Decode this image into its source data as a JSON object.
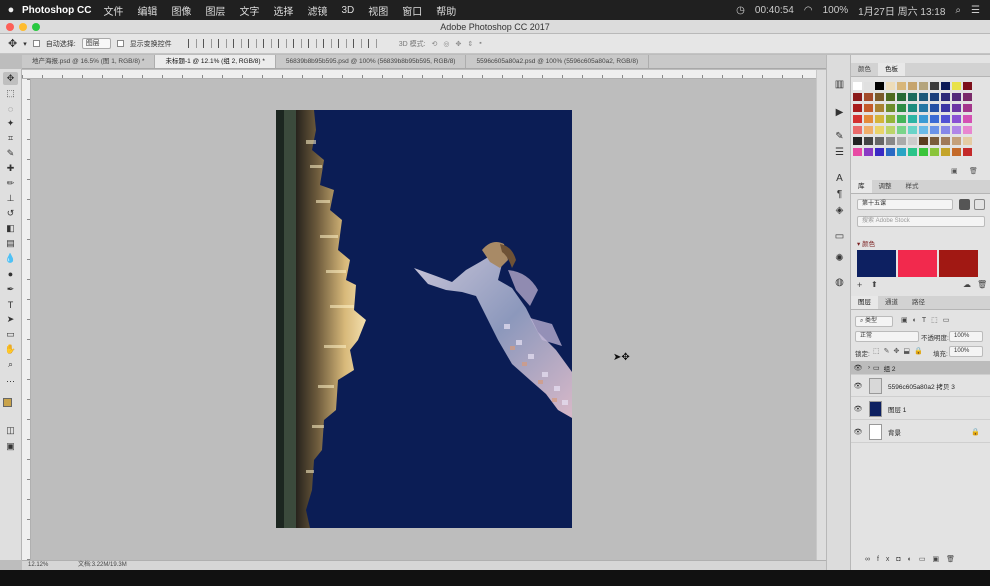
{
  "menubar": {
    "apple": "",
    "app": "Photoshop CC",
    "items": [
      "文件",
      "编辑",
      "图像",
      "图层",
      "文字",
      "选择",
      "滤镜",
      "3D",
      "视图",
      "窗口",
      "帮助"
    ],
    "right": {
      "clock": "00:40:54",
      "battery": "100%",
      "date": "1月27日 周六 13:18"
    }
  },
  "titlebar": {
    "title": "Adobe Photoshop CC 2017"
  },
  "options": {
    "auto_select_label": "自动选择:",
    "auto_select_value": "图层",
    "show_transform_label": "显示变换控件",
    "mode_3d_label": "3D 模式:"
  },
  "tabs": [
    {
      "label": "地产海报.psd @ 16.5% (图 1, RGB/8) *"
    },
    {
      "label": "未标题-1 @ 12.1% (组 2, RGB/8) *"
    },
    {
      "label": "56839b8b95b595.psd @ 100% (56839b8b95b595, RGB/8)"
    },
    {
      "label": "5596c605a80a2.psd @ 100% (5596c605a80a2, RGB/8)"
    }
  ],
  "status": {
    "zoom": "12.12%",
    "doc": "文档:3.22M/19.3M"
  },
  "panels": {
    "swatch_tabs": [
      "颜色",
      "色板"
    ],
    "library_tabs": [
      "库",
      "调整",
      "样式"
    ],
    "library_select": "第十五课",
    "library_search": "搜索 Adobe Stock",
    "library_colors_label": "颜色",
    "library_colors": [
      "#0d2061",
      "#f2294d",
      "#a11813"
    ],
    "layers_tabs": [
      "图层",
      "通道",
      "路径"
    ],
    "layer_filter": "类型",
    "blend_mode": "正常",
    "opacity_label": "不透明度:",
    "opacity_value": "100%",
    "lock_label": "锁定:",
    "fill_label": "填充:",
    "fill_value": "100%",
    "layers": [
      {
        "name": "组 2",
        "type": "group",
        "selected": true
      },
      {
        "name": "5596c605a80a2 拷贝 3",
        "type": "image",
        "selected": false
      },
      {
        "name": "图层 1",
        "type": "fill",
        "selected": false
      },
      {
        "name": "背景",
        "type": "background",
        "selected": false
      }
    ]
  },
  "swatch_rows": [
    [
      "#ffffff",
      "#e0e0e0",
      "#000000",
      "#eddcb9",
      "#d8b67a",
      "#c6a46d",
      "#b4a47c",
      "#3c3c3c",
      "#0c1a56",
      "#e8e24a",
      "#7d0f1b"
    ],
    [
      "#8b1a1a",
      "#a34a2a",
      "#7b5a2a",
      "#4e6a20",
      "#276a36",
      "#1c6b5e",
      "#1e5a7a",
      "#1c3f7a",
      "#2d2a78",
      "#532a7a",
      "#7a2a6a"
    ],
    [
      "#a81c1c",
      "#c45a2a",
      "#a88232",
      "#6c8c2c",
      "#2e8c44",
      "#1c8c7e",
      "#2478a4",
      "#2450a4",
      "#3c36a4",
      "#6c36a4",
      "#a4368c"
    ],
    [
      "#d43030",
      "#e48a3a",
      "#d4b43a",
      "#94b43a",
      "#44b45a",
      "#2cb4a4",
      "#3a9ad4",
      "#3a6ad4",
      "#5050d4",
      "#8a50d4",
      "#d450b4"
    ],
    [
      "#ea6a6a",
      "#f0ae6a",
      "#ead46a",
      "#bcd46a",
      "#7ad48a",
      "#6ad4c8",
      "#6abae8",
      "#6a92e8",
      "#8686e8",
      "#b086e8",
      "#e886d0"
    ],
    [
      "#222222",
      "#444444",
      "#666666",
      "#888888",
      "#aaaaaa",
      "#cccccc",
      "#5a3c1e",
      "#7a5a3a",
      "#a07a5a",
      "#c4a07a",
      "#e4cca4"
    ],
    [
      "#e84aa4",
      "#8a3ac4",
      "#3a2ac4",
      "#2a6ac4",
      "#2aa4c4",
      "#2ac48a",
      "#3ac43a",
      "#8ac43a",
      "#c4a42a",
      "#c46a2a",
      "#c42a2a"
    ]
  ]
}
